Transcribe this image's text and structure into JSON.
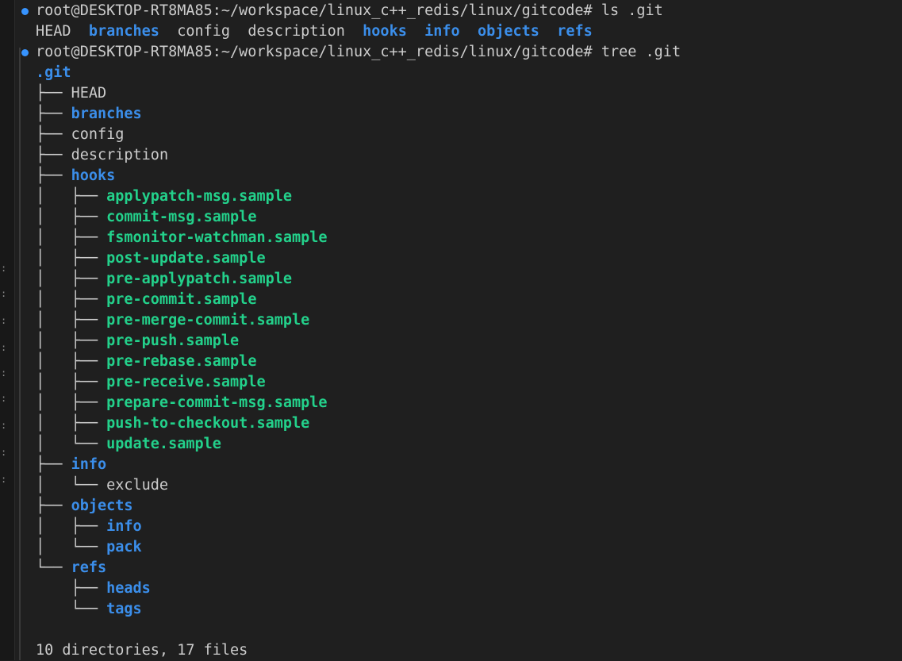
{
  "theme": {
    "background": "#1f1f1f",
    "fg": "#cccccc",
    "dir_color": "#3b8eea",
    "exe_color": "#23d18b",
    "marker_color": "#3794ff"
  },
  "commands": [
    {
      "prompt": "root@DESKTOP-RT8MA85:~/workspace/linux_c++_redis/linux/gitcode#",
      "command": "ls .git"
    },
    {
      "prompt": "root@DESKTOP-RT8MA85:~/workspace/linux_c++_redis/linux/gitcode#",
      "command": "tree .git"
    }
  ],
  "ls_output": [
    {
      "name": "HEAD",
      "type": "file"
    },
    {
      "name": "branches",
      "type": "dir"
    },
    {
      "name": "config",
      "type": "file"
    },
    {
      "name": "description",
      "type": "file"
    },
    {
      "name": "hooks",
      "type": "dir"
    },
    {
      "name": "info",
      "type": "dir"
    },
    {
      "name": "objects",
      "type": "dir"
    },
    {
      "name": "refs",
      "type": "dir"
    }
  ],
  "tree_root": ".git",
  "tree": [
    {
      "prefix": "├── ",
      "name": "HEAD",
      "type": "file"
    },
    {
      "prefix": "├── ",
      "name": "branches",
      "type": "dir"
    },
    {
      "prefix": "├── ",
      "name": "config",
      "type": "file"
    },
    {
      "prefix": "├── ",
      "name": "description",
      "type": "file"
    },
    {
      "prefix": "├── ",
      "name": "hooks",
      "type": "dir"
    },
    {
      "prefix": "│   ├── ",
      "name": "applypatch-msg.sample",
      "type": "exe"
    },
    {
      "prefix": "│   ├── ",
      "name": "commit-msg.sample",
      "type": "exe"
    },
    {
      "prefix": "│   ├── ",
      "name": "fsmonitor-watchman.sample",
      "type": "exe"
    },
    {
      "prefix": "│   ├── ",
      "name": "post-update.sample",
      "type": "exe"
    },
    {
      "prefix": "│   ├── ",
      "name": "pre-applypatch.sample",
      "type": "exe"
    },
    {
      "prefix": "│   ├── ",
      "name": "pre-commit.sample",
      "type": "exe"
    },
    {
      "prefix": "│   ├── ",
      "name": "pre-merge-commit.sample",
      "type": "exe"
    },
    {
      "prefix": "│   ├── ",
      "name": "pre-push.sample",
      "type": "exe"
    },
    {
      "prefix": "│   ├── ",
      "name": "pre-rebase.sample",
      "type": "exe"
    },
    {
      "prefix": "│   ├── ",
      "name": "pre-receive.sample",
      "type": "exe"
    },
    {
      "prefix": "│   ├── ",
      "name": "prepare-commit-msg.sample",
      "type": "exe"
    },
    {
      "prefix": "│   ├── ",
      "name": "push-to-checkout.sample",
      "type": "exe"
    },
    {
      "prefix": "│   └── ",
      "name": "update.sample",
      "type": "exe"
    },
    {
      "prefix": "├── ",
      "name": "info",
      "type": "dir"
    },
    {
      "prefix": "│   └── ",
      "name": "exclude",
      "type": "file"
    },
    {
      "prefix": "├── ",
      "name": "objects",
      "type": "dir"
    },
    {
      "prefix": "│   ├── ",
      "name": "info",
      "type": "dir"
    },
    {
      "prefix": "│   └── ",
      "name": "pack",
      "type": "dir"
    },
    {
      "prefix": "└── ",
      "name": "refs",
      "type": "dir"
    },
    {
      "prefix": "    ├── ",
      "name": "heads",
      "type": "dir"
    },
    {
      "prefix": "    └── ",
      "name": "tags",
      "type": "dir"
    }
  ],
  "summary": "10 directories, 17 files",
  "gutter_marks": ":"
}
